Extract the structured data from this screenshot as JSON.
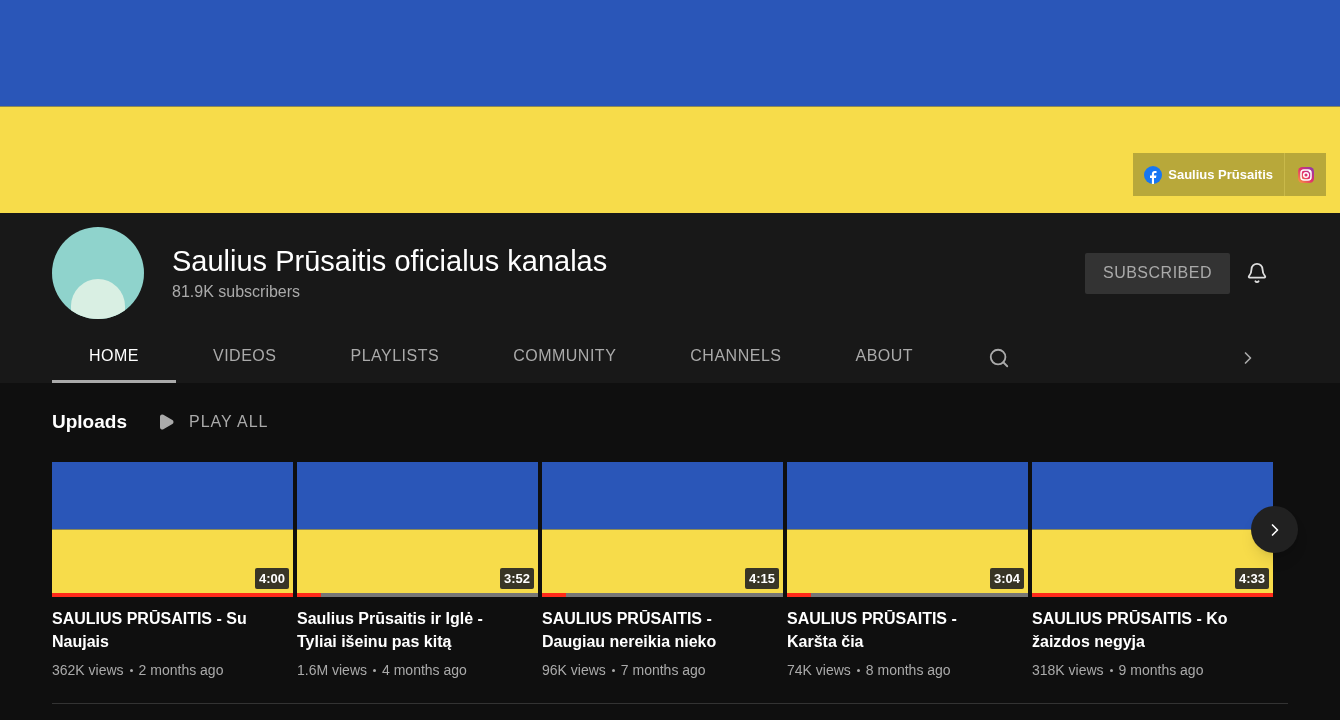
{
  "banner": {
    "links": [
      {
        "kind": "facebook",
        "label": "Saulius Prūsaitis"
      },
      {
        "kind": "instagram"
      }
    ]
  },
  "channel": {
    "name": "Saulius Prūsaitis oficialus kanalas",
    "subscribers": "81.9K subscribers",
    "subscribe_button": "SUBSCRIBED"
  },
  "tabs": [
    {
      "label": "HOME",
      "selected": true
    },
    {
      "label": "VIDEOS",
      "selected": false
    },
    {
      "label": "PLAYLISTS",
      "selected": false
    },
    {
      "label": "COMMUNITY",
      "selected": false
    },
    {
      "label": "CHANNELS",
      "selected": false
    },
    {
      "label": "ABOUT",
      "selected": false
    }
  ],
  "section": {
    "title": "Uploads",
    "play_all": "PLAY ALL"
  },
  "videos": [
    {
      "title": "SAULIUS PRŪSAITIS - Su Naujais",
      "duration": "4:00",
      "level": 1,
      "views": "362K views",
      "age": "2 months ago"
    },
    {
      "title": "Saulius Prūsaitis ir Iglė - Tyliai išeinu pas kitą",
      "duration": "3:52",
      "level": 0.1,
      "views": "1.6M views",
      "age": "4 months ago"
    },
    {
      "title": "SAULIUS PRŪSAITIS - Daugiau nereikia nieko",
      "duration": "4:15",
      "level": 0.1,
      "views": "96K views",
      "age": "7 months ago"
    },
    {
      "title": "SAULIUS PRŪSAITIS - Karšta čia",
      "duration": "3:04",
      "level": 0.1,
      "views": "74K views",
      "age": "8 months ago"
    },
    {
      "title": "SAULIUS PRŪSAITIS - Ko žaizdos negyja",
      "duration": "4:33",
      "level": 1,
      "views": "318K views",
      "age": "9 months ago"
    }
  ]
}
